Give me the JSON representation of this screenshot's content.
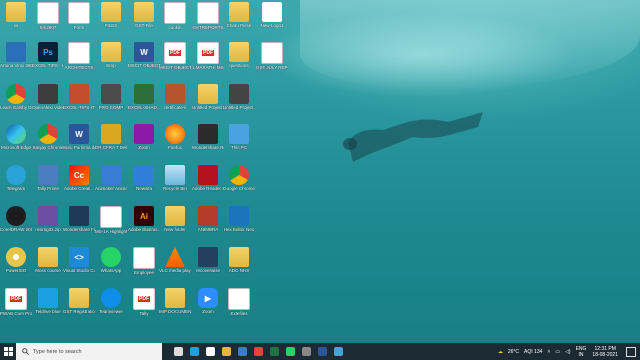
{
  "desktop": {
    "icons": [
      {
        "label": "ss",
        "type": "folder"
      },
      {
        "label": "Arturia Vinci 360",
        "type": "app",
        "color": "#2a6fb8"
      },
      {
        "label": "Learn Gatsby Drawflex",
        "type": "chrome"
      },
      {
        "label": "Microsoft Edge",
        "type": "edge"
      },
      {
        "label": "Telegram",
        "type": "telegram"
      },
      {
        "label": "CorelDRAW 2019 (64-Bit)",
        "type": "corel"
      },
      {
        "label": "PowerISO",
        "type": "poweriso"
      },
      {
        "label": "PWAB Cum Proposal",
        "type": "pdf"
      },
      {
        "label": "Sm2607",
        "type": "doc"
      },
      {
        "label": "EXCEL TIPS - HINDI NE",
        "type": "photoshop"
      },
      {
        "label": "OpenAlexi Video Elite",
        "type": "app",
        "color": "#3d3d3d"
      },
      {
        "label": "Sanjay Chrome",
        "type": "chrome"
      },
      {
        "label": "Tally.Prime",
        "type": "app",
        "color": "#4a7dbf"
      },
      {
        "label": "msimg32.zip",
        "type": "zip"
      },
      {
        "label": "Moss course",
        "type": "folder"
      },
      {
        "label": "Teldrive blue",
        "type": "app",
        "color": "#1ba1e2"
      },
      {
        "label": "Form",
        "type": "doc"
      },
      {
        "label": "ARCHITECTS",
        "type": "doc"
      },
      {
        "label": "EXCEL-TIPS-ITO",
        "type": "app",
        "color": "#c24e2e"
      },
      {
        "label": "Suru Purnima docx",
        "type": "word"
      },
      {
        "label": "Adobe Creati...",
        "type": "adobe"
      },
      {
        "label": "Wondershare Filmora X",
        "type": "app",
        "color": "#1d3a57"
      },
      {
        "label": "Visual Studio Code",
        "type": "vscode"
      },
      {
        "label": "GST Registration",
        "type": "folder"
      },
      {
        "label": "FILES",
        "type": "folder"
      },
      {
        "label": "Emp",
        "type": "folder"
      },
      {
        "label": "PRO COMP",
        "type": "app",
        "color": "#4b4b4b"
      },
      {
        "label": "DR.CFRA 7 Dell",
        "type": "app",
        "color": "#d8a821"
      },
      {
        "label": "Animaker Animatio...",
        "type": "app",
        "color": "#3a7bd5"
      },
      {
        "label": "MS-1A Highlighter",
        "type": "doc"
      },
      {
        "label": "WhatsApp",
        "type": "whatsapp"
      },
      {
        "label": "Teamviewer",
        "type": "teamviewer"
      },
      {
        "label": "GST-File",
        "type": "folder"
      },
      {
        "label": "MSCIT OBJECTI...",
        "type": "word"
      },
      {
        "label": "EXCEL-SHAD...",
        "type": "app",
        "color": "#2d6e3a"
      },
      {
        "label": "Zoom",
        "type": "app",
        "color": "#8b1aa8"
      },
      {
        "label": "Newsifa",
        "type": "app",
        "color": "#2f7ed8"
      },
      {
        "label": "Adobe Illustrat...",
        "type": "illustrator"
      },
      {
        "label": "Employee",
        "type": "doc"
      },
      {
        "label": "Tally",
        "type": "pdf"
      },
      {
        "label": "cookin",
        "type": "doc"
      },
      {
        "label": "MSCIT OBJECTI...",
        "type": "pdf"
      },
      {
        "label": "certificate-ii",
        "type": "app",
        "color": "#b5542e"
      },
      {
        "label": "Firefox",
        "type": "firefox"
      },
      {
        "label": "Recycle Bin",
        "type": "recycle"
      },
      {
        "label": "New folder",
        "type": "folder"
      },
      {
        "label": "VLC media player",
        "type": "vlc"
      },
      {
        "label": "IMP DOCUMENTS",
        "type": "folder"
      },
      {
        "label": "GSTREPORTS",
        "type": "doc"
      },
      {
        "label": "1.MARATHI MSCIT FIN...",
        "type": "pdf"
      },
      {
        "label": "Untitled Project.assets",
        "type": "folder"
      },
      {
        "label": "Wondershare Recoverit",
        "type": "app",
        "color": "#2b2b2b"
      },
      {
        "label": "Adobe Reader XI",
        "type": "app",
        "color": "#b3121e"
      },
      {
        "label": "ANIMBRA",
        "type": "app",
        "color": "#b43a2a"
      },
      {
        "label": "recoverwise",
        "type": "app",
        "color": "#23405e"
      },
      {
        "label": "Zoom",
        "type": "zoom"
      },
      {
        "label": "Charu Piece",
        "type": "folder"
      },
      {
        "label": "questions",
        "type": "folder"
      },
      {
        "label": "Untitled Project.sfp",
        "type": "app",
        "color": "#444"
      },
      {
        "label": "This PC",
        "type": "thispc"
      },
      {
        "label": "Google Chrome",
        "type": "chrome"
      },
      {
        "label": "Hex Editor Neo",
        "type": "app",
        "color": "#1c75bc"
      },
      {
        "label": "ADC-NHS",
        "type": "folder"
      },
      {
        "label": "Extefiles",
        "type": "doc"
      },
      {
        "label": "New-Logo1",
        "type": "app",
        "color": "#ffffff"
      },
      {
        "label": "GST JULY REPORTS",
        "type": "doc"
      }
    ]
  },
  "taskbar": {
    "search_placeholder": "Type here to search",
    "pinned": [
      {
        "name": "task-view",
        "color": "#dddddd"
      },
      {
        "name": "edge",
        "color": "#1aa0e8"
      },
      {
        "name": "mail",
        "color": "#ffffff"
      },
      {
        "name": "file-explorer",
        "color": "#e6b73c"
      },
      {
        "name": "store",
        "color": "#3a7bd5"
      },
      {
        "name": "chrome",
        "color": "#e0463d"
      },
      {
        "name": "excel",
        "color": "#1f7244"
      },
      {
        "name": "whatsapp",
        "color": "#25d366"
      },
      {
        "name": "obs",
        "color": "#888888"
      },
      {
        "name": "word",
        "color": "#2b579a"
      },
      {
        "name": "app-generic",
        "color": "#3fa7d6"
      }
    ],
    "weather": "26°C",
    "aqi": "AQI 134",
    "language": "ENG",
    "region": "IN",
    "time": "12:31 PM",
    "date": "18-08-2021"
  }
}
